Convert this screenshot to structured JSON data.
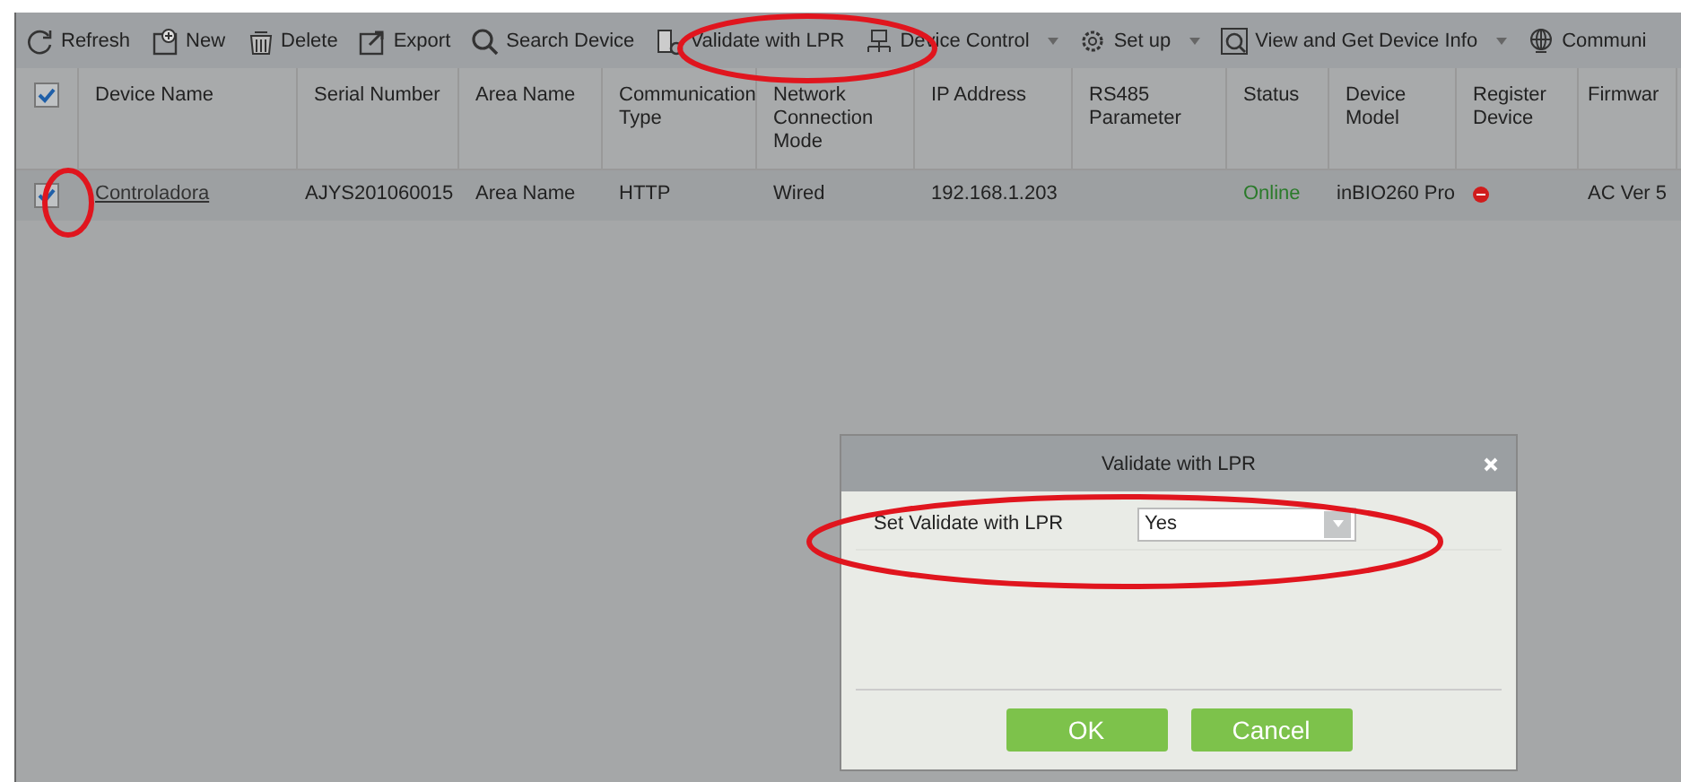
{
  "toolbar": [
    {
      "label": "Refresh",
      "dropdown": false
    },
    {
      "label": "New",
      "dropdown": false
    },
    {
      "label": "Delete",
      "dropdown": false
    },
    {
      "label": "Export",
      "dropdown": false
    },
    {
      "label": "Search Device",
      "dropdown": false
    },
    {
      "label": "Validate with LPR",
      "dropdown": false
    },
    {
      "label": "Device Control",
      "dropdown": true
    },
    {
      "label": "Set up",
      "dropdown": true
    },
    {
      "label": "View and Get Device Info",
      "dropdown": true
    },
    {
      "label": "Communi",
      "dropdown": false
    }
  ],
  "table": {
    "all_checked": true,
    "columns": [
      "Device Name",
      "Serial Number",
      "Area Name",
      "Communication Type",
      "Network Connection Mode",
      "IP Address",
      "RS485 Parameter",
      "Status",
      "Device Model",
      "Register Device",
      "Firmwar"
    ],
    "rows": [
      {
        "checked": true,
        "cells": [
          "Controladora",
          "AJYS201060015",
          "Area Name",
          "HTTP",
          "Wired",
          "192.168.1.203",
          "",
          "Online",
          "inBIO260 Pro",
          "",
          "AC Ver 5"
        ],
        "online": true,
        "registered": false
      }
    ]
  },
  "dialog": {
    "title": "Validate with LPR",
    "field_label": "Set Validate with LPR",
    "field_value": "Yes",
    "buttons": [
      "OK",
      "Cancel"
    ]
  }
}
